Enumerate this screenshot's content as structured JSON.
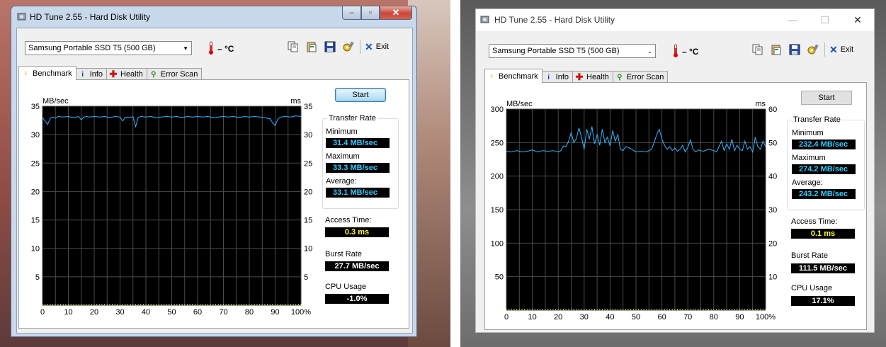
{
  "left_window": {
    "title": "HD Tune 2.55 - Hard Disk Utility",
    "drive": "Samsung Portable SSD T5 (500 GB)",
    "temperature": "– °C",
    "exit_label": "Exit",
    "tabs": [
      "Benchmark",
      "Info",
      "Health",
      "Error Scan"
    ],
    "start_label": "Start",
    "transfer_rate_title": "Transfer Rate",
    "minimum_label": "Minimum",
    "minimum_value": "31.4 MB/sec",
    "maximum_label": "Maximum",
    "maximum_value": "33.3 MB/sec",
    "average_label": "Average:",
    "average_value": "33.1 MB/sec",
    "access_time_label": "Access Time:",
    "access_time_value": "0.3 ms",
    "burst_rate_label": "Burst Rate",
    "burst_rate_value": "27.7 MB/sec",
    "cpu_usage_label": "CPU Usage",
    "cpu_usage_value": "-1.0%"
  },
  "right_window": {
    "title": "HD Tune 2.55 - Hard Disk Utility",
    "drive": "Samsung Portable SSD T5 (500 GB)",
    "temperature": "– °C",
    "exit_label": "Exit",
    "tabs": [
      "Benchmark",
      "Info",
      "Health",
      "Error Scan"
    ],
    "start_label": "Start",
    "transfer_rate_title": "Transfer Rate",
    "minimum_label": "Minimum",
    "minimum_value": "232.4 MB/sec",
    "maximum_label": "Maximum",
    "maximum_value": "274.2 MB/sec",
    "average_label": "Average:",
    "average_value": "243.2 MB/sec",
    "access_time_label": "Access Time:",
    "access_time_value": "0.1 ms",
    "burst_rate_label": "Burst Rate",
    "burst_rate_value": "111.5 MB/sec",
    "cpu_usage_label": "CPU Usage",
    "cpu_usage_value": "17.1%"
  },
  "colors": {
    "line": "#33b5ff",
    "access_points": "#ffff33",
    "grid": "#4a4a4a",
    "plot_bg": "#000000"
  },
  "chart_data": [
    {
      "type": "line",
      "ylabel": "MB/sec",
      "y2label": "ms",
      "ylim": [
        0,
        35
      ],
      "y2lim": [
        0,
        35
      ],
      "yticks": [
        "35",
        "30",
        "25",
        "20",
        "15",
        "10",
        "5"
      ],
      "y2ticks": [
        "35",
        "30",
        "25",
        "20",
        "15",
        "10",
        "5"
      ],
      "xticks": [
        "0",
        "10",
        "20",
        "30",
        "40",
        "50",
        "60",
        "70",
        "80",
        "90",
        "100%"
      ],
      "grid": true,
      "series": [
        {
          "x": [
            0,
            1,
            2,
            3,
            4,
            5,
            6,
            8,
            10,
            12,
            14,
            15,
            16,
            17,
            18,
            20,
            22,
            24,
            26,
            28,
            30,
            31,
            32,
            33,
            34,
            35,
            36,
            37,
            38,
            40,
            42,
            44,
            46,
            48,
            50,
            52,
            54,
            56,
            58,
            60,
            62,
            64,
            66,
            68,
            70,
            72,
            74,
            76,
            78,
            80,
            82,
            84,
            86,
            88,
            89,
            90,
            91,
            92,
            94,
            96,
            98,
            100
          ],
          "values": [
            33.0,
            32.4,
            31.8,
            32.9,
            33.1,
            32.9,
            33.2,
            33.1,
            33.2,
            33.0,
            33.2,
            32.6,
            33.1,
            33.2,
            33.1,
            33.2,
            33.1,
            33.2,
            33.0,
            33.2,
            33.1,
            32.4,
            33.0,
            33.1,
            33.0,
            33.2,
            31.4,
            33.0,
            33.2,
            33.1,
            33.2,
            33.0,
            33.1,
            33.2,
            33.1,
            33.2,
            33.0,
            33.2,
            33.1,
            33.2,
            33.1,
            33.2,
            33.0,
            33.1,
            33.2,
            33.1,
            33.2,
            33.0,
            33.2,
            33.1,
            33.2,
            33.1,
            33.0,
            32.8,
            32.1,
            31.6,
            32.7,
            33.1,
            33.2,
            33.1,
            33.3,
            33.2
          ]
        }
      ]
    },
    {
      "type": "line",
      "ylabel": "MB/sec",
      "y2label": "ms",
      "ylim": [
        0,
        300
      ],
      "y2lim": [
        0,
        60
      ],
      "yticks": [
        "300",
        "250",
        "200",
        "150",
        "100",
        "50"
      ],
      "y2ticks": [
        "60",
        "50",
        "40",
        "30",
        "20",
        "10"
      ],
      "xticks": [
        "0",
        "10",
        "20",
        "30",
        "40",
        "50",
        "60",
        "70",
        "80",
        "90",
        "100%"
      ],
      "grid": true,
      "series": [
        {
          "x": [
            0,
            2,
            4,
            6,
            8,
            10,
            12,
            14,
            16,
            18,
            20,
            21,
            22,
            23,
            24,
            25,
            26,
            27,
            28,
            29,
            30,
            31,
            32,
            33,
            34,
            35,
            36,
            37,
            38,
            39,
            40,
            41,
            42,
            43,
            44,
            45,
            46,
            48,
            50,
            52,
            54,
            56,
            57,
            58,
            59,
            60,
            61,
            62,
            63,
            64,
            65,
            66,
            67,
            68,
            69,
            70,
            71,
            72,
            73,
            74,
            75,
            76,
            78,
            80,
            81,
            82,
            83,
            84,
            85,
            86,
            87,
            88,
            89,
            90,
            91,
            92,
            93,
            94,
            95,
            96,
            97,
            98,
            99,
            100
          ],
          "values": [
            237,
            236,
            238,
            236,
            237,
            239,
            236,
            238,
            237,
            238,
            236,
            238,
            245,
            244,
            252,
            265,
            250,
            256,
            272,
            258,
            240,
            270,
            255,
            274,
            248,
            262,
            246,
            270,
            250,
            258,
            245,
            268,
            252,
            262,
            240,
            238,
            244,
            241,
            236,
            237,
            236,
            240,
            250,
            262,
            270,
            255,
            246,
            240,
            244,
            238,
            242,
            237,
            240,
            246,
            236,
            243,
            254,
            240,
            236,
            239,
            238,
            237,
            240,
            238,
            236,
            244,
            252,
            238,
            248,
            240,
            255,
            238,
            246,
            240,
            238,
            252,
            240,
            244,
            236,
            258,
            244,
            240,
            252,
            244
          ]
        }
      ]
    }
  ]
}
